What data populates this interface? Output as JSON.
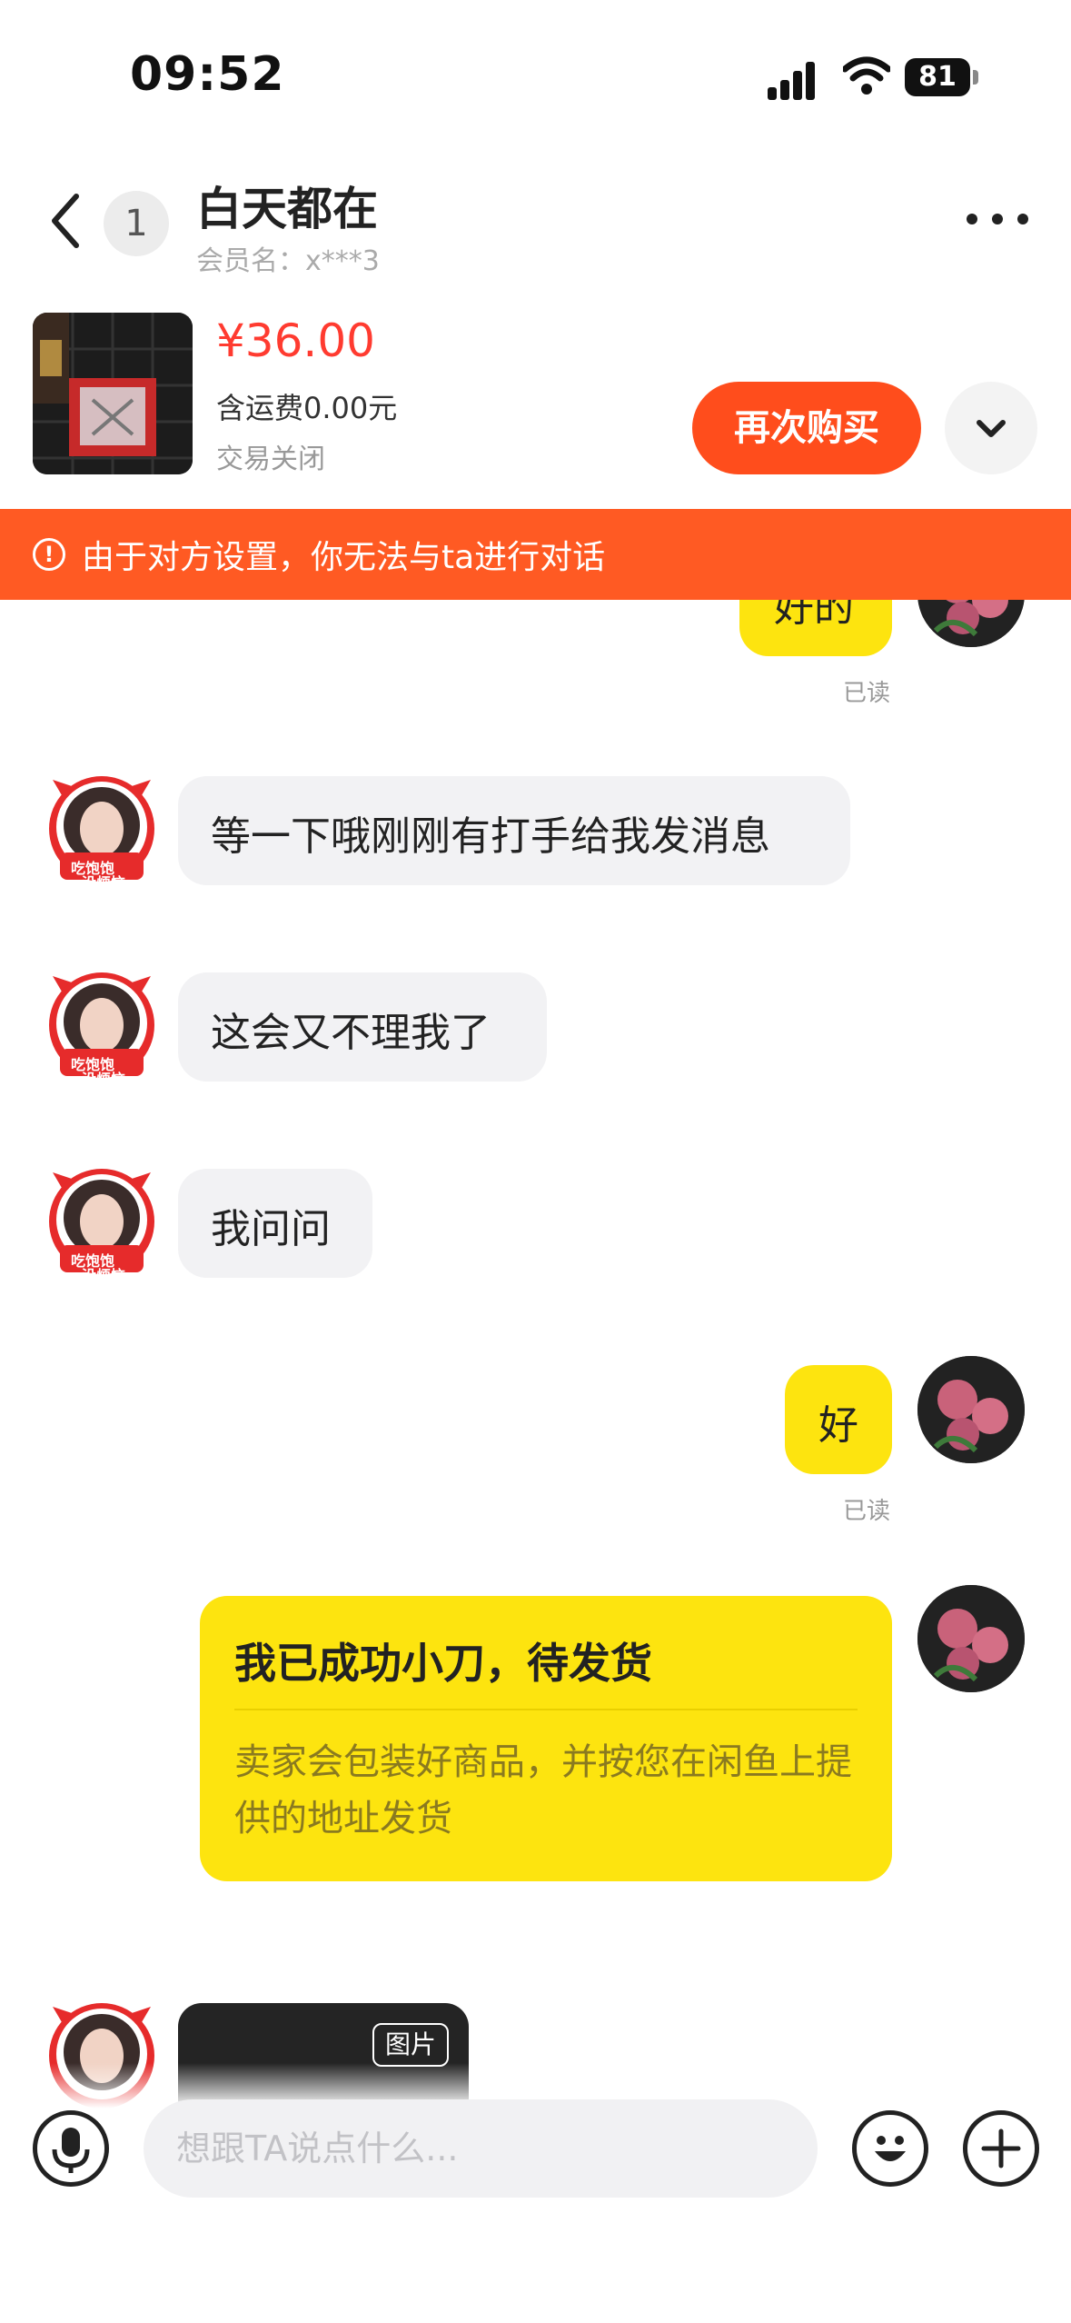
{
  "status_bar": {
    "time": "09:52",
    "battery": "81"
  },
  "header": {
    "unread_count": "1",
    "title": "白天都在",
    "subtitle": "会员名：x***3"
  },
  "product": {
    "price": "¥36.00",
    "shipping": "含运费0.00元",
    "status": "交易关闭",
    "buy_again_label": "再次购买"
  },
  "banner": {
    "text": "由于对方设置，你无法与ta进行对话"
  },
  "messages": [
    {
      "from": "me",
      "text": "好的",
      "read": "已读"
    },
    {
      "from": "them",
      "text": "等一下哦刚刚有打手给我发消息"
    },
    {
      "from": "them",
      "text": "这会又不理我了"
    },
    {
      "from": "them",
      "text": "我问问"
    },
    {
      "from": "me",
      "text": "好",
      "read": "已读"
    }
  ],
  "card": {
    "title": "我已成功小刀，待发货",
    "body": "卖家会包装好商品，并按您在闲鱼上提供的地址发货"
  },
  "image_message": {
    "tag": "图片"
  },
  "avatar_stamp": {
    "line1": "吃饱饱",
    "line2": "没烦恼"
  },
  "input": {
    "placeholder": "想跟TA说点什么..."
  },
  "colors": {
    "accent": "#ff4d1c",
    "banner": "#ff5a23",
    "my_bubble": "#fde40f",
    "their_bubble": "#f2f2f4",
    "price": "#ff3b30"
  }
}
